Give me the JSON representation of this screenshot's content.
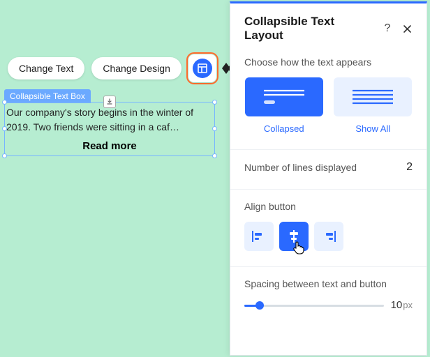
{
  "toolbar": {
    "change_text": "Change Text",
    "change_design": "Change Design"
  },
  "widget": {
    "label": "Collapsible Text Box",
    "text": "Our company's story begins in the winter of 2019. Two friends were sitting in a caf…",
    "read_more": "Read more"
  },
  "panel": {
    "title": "Collapsible Text Layout",
    "section_mode_label": "Choose how the text appears",
    "mode_collapsed": "Collapsed",
    "mode_showall": "Show All",
    "lines_label": "Number of lines displayed",
    "lines_value": "2",
    "align_label": "Align button",
    "spacing_label": "Spacing between text and button",
    "spacing_value": "10",
    "spacing_unit": "px"
  }
}
